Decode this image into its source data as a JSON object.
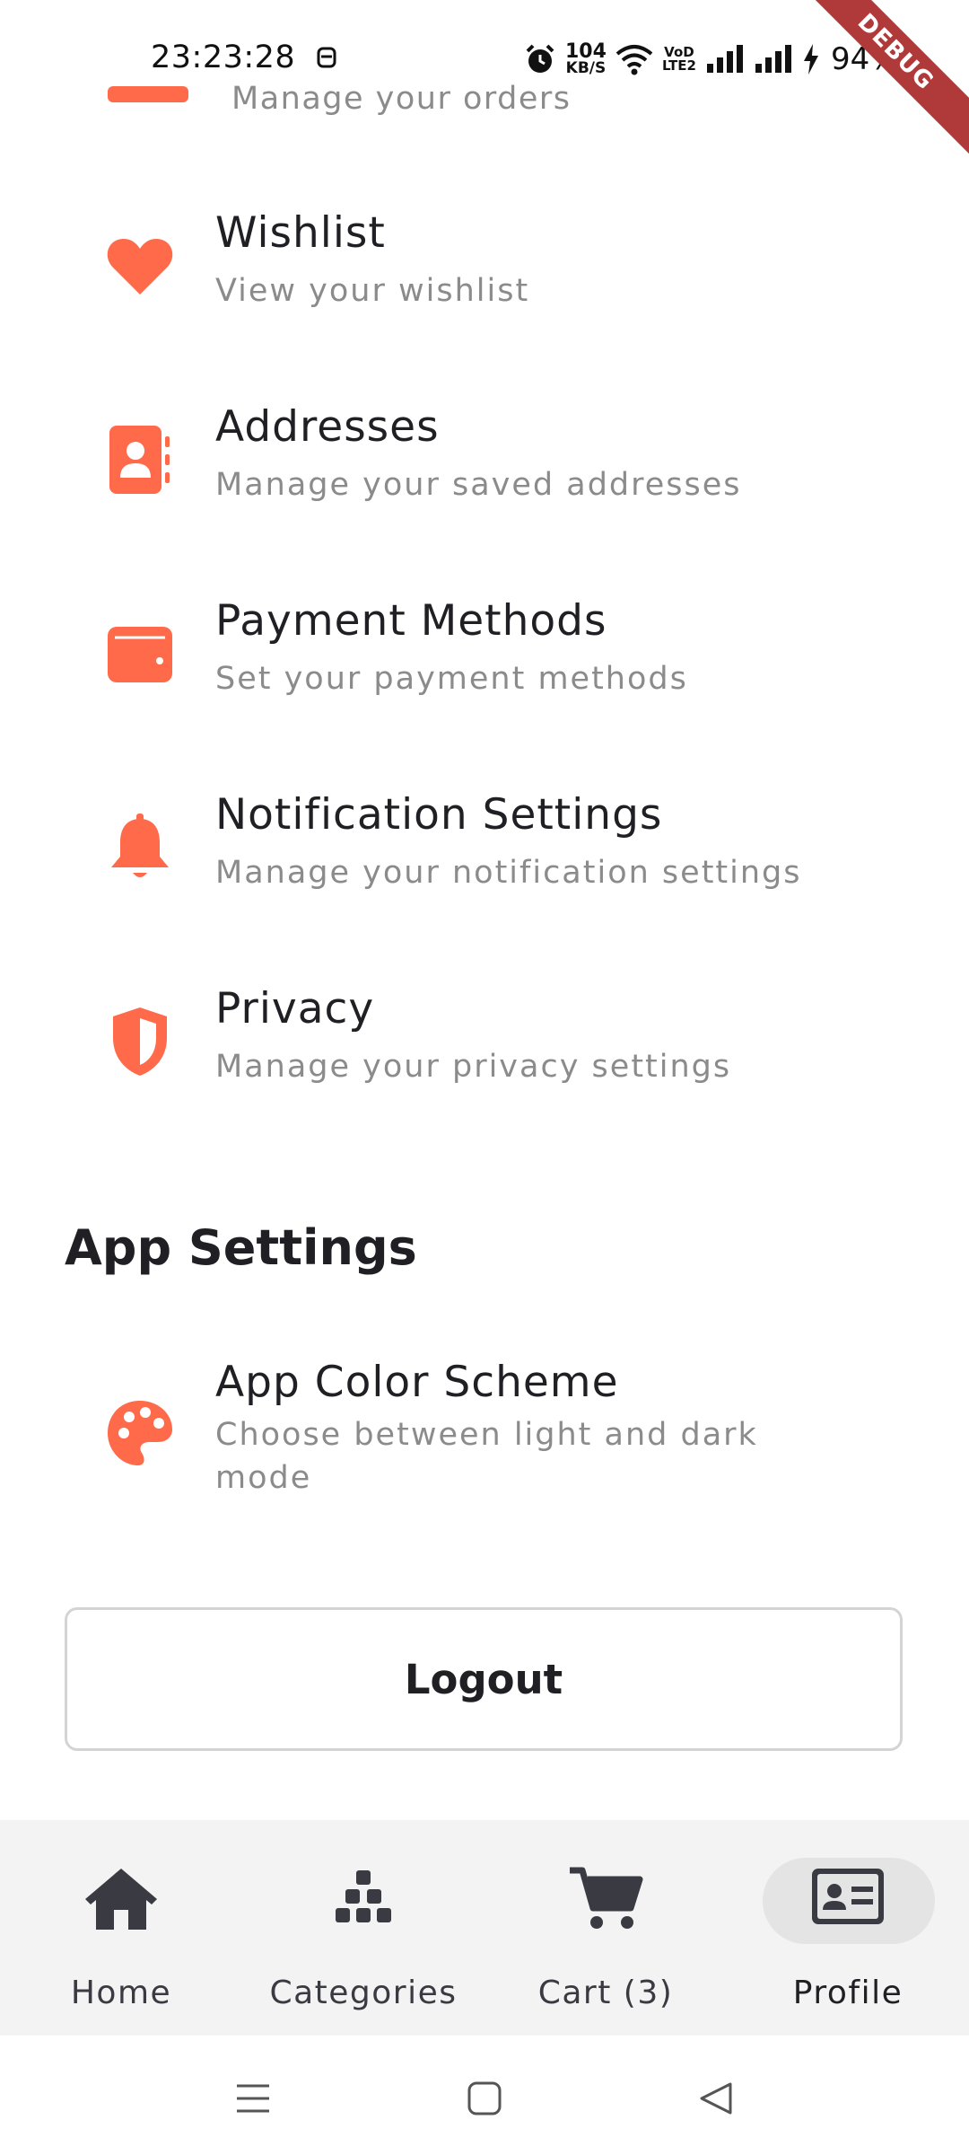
{
  "status_bar": {
    "time": "23:23:28",
    "net_speed_value": "104",
    "net_speed_unit": "KB/S",
    "volte_top": "VoD",
    "volte_bottom": "LTE2",
    "battery": "94%",
    "debug_label": "DEBUG"
  },
  "clipped_item": {
    "subtitle": "Manage your orders"
  },
  "menu": {
    "items": [
      {
        "title": "Wishlist",
        "subtitle": "View your wishlist",
        "icon": "heart-icon"
      },
      {
        "title": "Addresses",
        "subtitle": "Manage your saved addresses",
        "icon": "contact-book-icon"
      },
      {
        "title": "Payment Methods",
        "subtitle": "Set your payment methods",
        "icon": "wallet-icon"
      },
      {
        "title": "Notification Settings",
        "subtitle": "Manage your notification settings",
        "icon": "bell-icon"
      },
      {
        "title": "Privacy",
        "subtitle": "Manage your privacy settings",
        "icon": "shield-icon"
      }
    ]
  },
  "app_settings": {
    "heading": "App Settings",
    "items": [
      {
        "title": "App Color Scheme",
        "subtitle": "Choose between light and dark mode",
        "icon": "palette-icon"
      }
    ]
  },
  "logout_label": "Logout",
  "bottom_nav": {
    "items": [
      {
        "label": "Home",
        "icon": "home-icon",
        "active": false
      },
      {
        "label": "Categories",
        "icon": "categories-icon",
        "active": false
      },
      {
        "label": "Cart (3)",
        "icon": "cart-icon",
        "active": false
      },
      {
        "label": "Profile",
        "icon": "profile-card-icon",
        "active": true
      }
    ]
  },
  "colors": {
    "accent": "#ff6b4a",
    "text_primary": "#1f1f24",
    "text_secondary": "#8b8b8b",
    "nav_background": "#f3f3f3",
    "nav_active_pill": "#e4e4e4",
    "debug_ribbon": "#b03a3a"
  }
}
